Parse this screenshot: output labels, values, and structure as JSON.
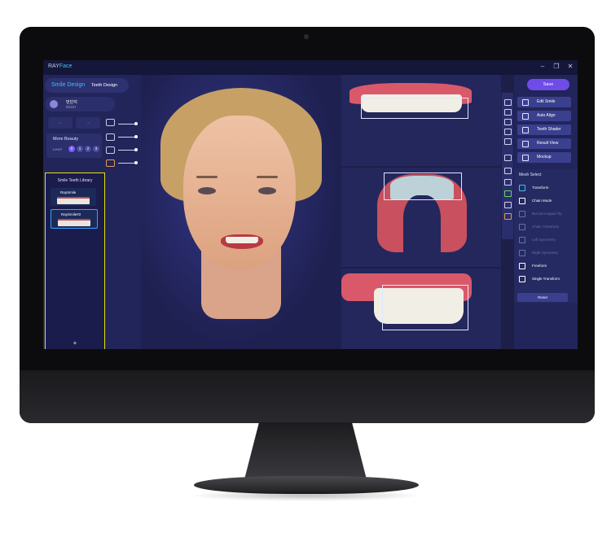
{
  "app": {
    "brand_prefix": "RAY",
    "brand_suffix": "Face"
  },
  "window": {
    "minimize": "–",
    "restore": "❐",
    "close": "✕"
  },
  "left": {
    "tab_active": "Smile Design",
    "tab_other": "Teeth Design",
    "user_name": "번민지",
    "user_id": "00157",
    "undo": "←",
    "redo": "→",
    "more_beauty": "More Beauty",
    "level_label": "Level",
    "levels": [
      "0",
      "1",
      "2",
      "3"
    ],
    "library_title": "Smile Teeth Library",
    "library_items": [
      "RaySmile",
      "RaySmile#2"
    ],
    "add": "+"
  },
  "right": {
    "save": "Save",
    "buttons": [
      "Edit Smile",
      "Auto Align",
      "Teeth Shader",
      "Result View",
      "Mockup"
    ],
    "mesh_title": "Mesh Select",
    "mesh_items": [
      {
        "label": "Transform",
        "enabled": true
      },
      {
        "label": "Chain Mode",
        "enabled": true
      },
      {
        "label": "Buccal-Lingual Tip",
        "enabled": false
      },
      {
        "label": "Chain Transform",
        "enabled": false
      },
      {
        "label": "Left Symmetry",
        "enabled": false
      },
      {
        "label": "Right Symmetry",
        "enabled": false
      },
      {
        "label": "Freeform",
        "enabled": true
      },
      {
        "label": "Single Transform",
        "enabled": true
      }
    ],
    "reset": "Reset"
  },
  "colors": {
    "accent": "#38c4ef",
    "save": "#6f4be8",
    "panel": "#22255a",
    "highlight": "#e6e300"
  }
}
